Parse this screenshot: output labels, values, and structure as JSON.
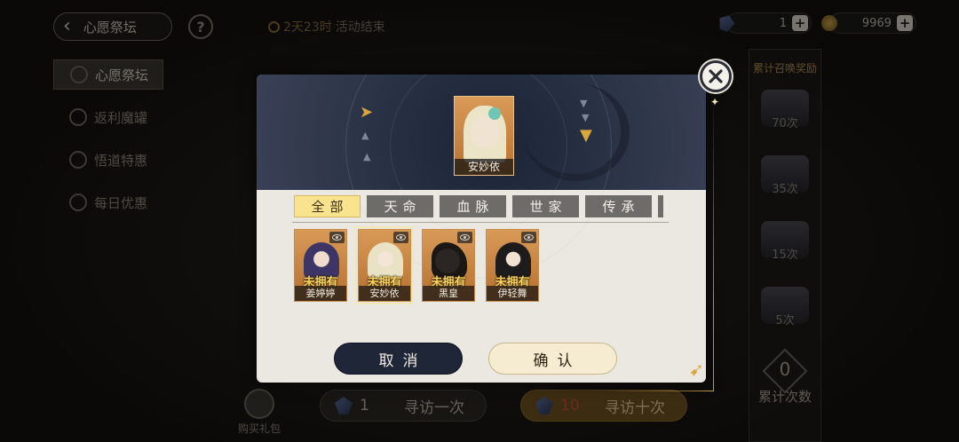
{
  "header": {
    "back_label": "心愿祭坛",
    "help_symbol": "?",
    "timer_highlight": "2天23时",
    "timer_text": "活动结束"
  },
  "currencies": [
    {
      "icon": "crystal-icon",
      "value": "1"
    },
    {
      "icon": "coin-icon",
      "value": "9969"
    }
  ],
  "sidebar": {
    "items": [
      {
        "label": "心愿祭坛",
        "active": true
      },
      {
        "label": "返利魔罐",
        "active": false
      },
      {
        "label": "悟道特惠",
        "active": false
      },
      {
        "label": "每日优惠",
        "active": false
      }
    ]
  },
  "rewards": {
    "title": "累计召唤奖励",
    "chests": [
      "70次",
      "35次",
      "15次",
      "5次"
    ],
    "count_value": "0",
    "count_label": "累计次数"
  },
  "bottom": {
    "gift_label": "购买礼包",
    "draw_one": {
      "count": "1",
      "label": "寻访一次"
    },
    "draw_ten": {
      "count": "10",
      "label": "寻访十次"
    }
  },
  "modal": {
    "selected_character": "安妙依",
    "tabs": [
      {
        "label": "全部",
        "active": true
      },
      {
        "label": "天命",
        "active": false
      },
      {
        "label": "血脉",
        "active": false
      },
      {
        "label": "世家",
        "active": false
      },
      {
        "label": "传承",
        "active": false
      }
    ],
    "characters": [
      {
        "name": "姜婷婷",
        "status": "未拥有",
        "selected": false
      },
      {
        "name": "安妙依",
        "status": "未拥有",
        "selected": true
      },
      {
        "name": "黑皇",
        "status": "未拥有",
        "selected": false
      },
      {
        "name": "伊轻舞",
        "status": "未拥有",
        "selected": false
      }
    ],
    "cancel_label": "取消",
    "confirm_label": "确认"
  },
  "colors": {
    "accent_gold": "#d9a63b",
    "tab_active": "#fae38e",
    "card_orange": "#d99a57",
    "status_yellow": "#f7d35a",
    "cancel_navy": "#1f2638"
  }
}
